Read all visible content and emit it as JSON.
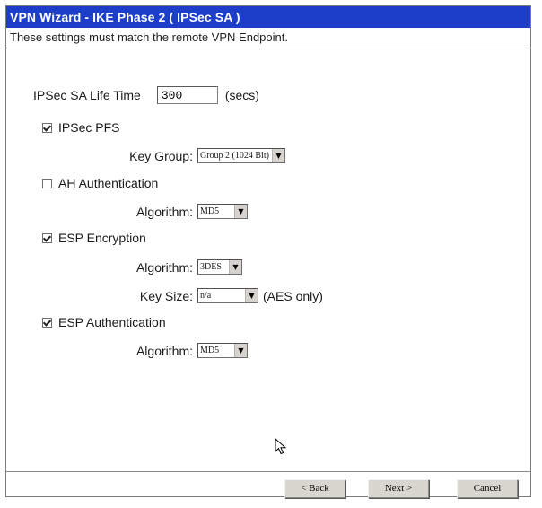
{
  "window": {
    "title": "VPN Wizard - IKE Phase 2 ( IPSec SA )",
    "subtitle": "These settings must match the remote VPN Endpoint."
  },
  "form": {
    "sa_lifetime": {
      "label": "IPSec SA Life Time",
      "value": "300",
      "unit": "(secs)"
    },
    "pfs": {
      "label": "IPSec PFS",
      "checked": true,
      "key_group_label": "Key Group:",
      "key_group_value": "Group 2 (1024 Bit)"
    },
    "ah_auth": {
      "label": "AH Authentication",
      "checked": false,
      "algorithm_label": "Algorithm:",
      "algorithm_value": "MD5"
    },
    "esp_enc": {
      "label": "ESP Encryption",
      "checked": true,
      "algorithm_label": "Algorithm:",
      "algorithm_value": "3DES",
      "key_size_label": "Key Size:",
      "key_size_value": "n/a",
      "key_size_note": "(AES only)"
    },
    "esp_auth": {
      "label": "ESP Authentication",
      "checked": true,
      "algorithm_label": "Algorithm:",
      "algorithm_value": "MD5"
    }
  },
  "buttons": {
    "back": "< Back",
    "next": "Next >",
    "cancel": "Cancel"
  },
  "colors": {
    "titlebar": "#1c3ec9",
    "button_face": "#d9d6d0"
  }
}
